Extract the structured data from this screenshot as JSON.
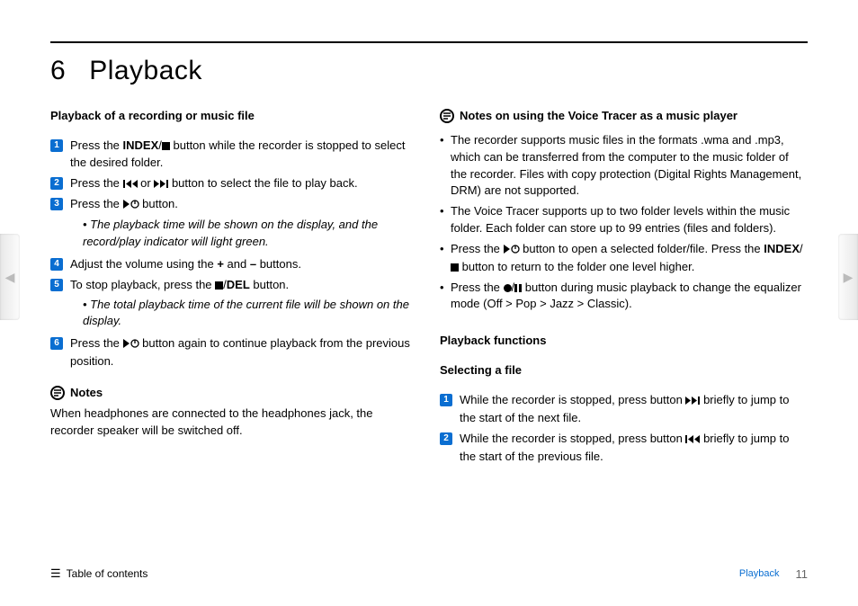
{
  "chapter_number": "6",
  "chapter_title": "Playback",
  "left": {
    "h1": "Playback of a recording or music file",
    "steps": [
      {
        "n": "1",
        "pre": "Press the ",
        "b1": "INDEX",
        "mid": "/",
        "icon": "stop",
        "post": " button while the recorder is stopped to select the desired folder."
      },
      {
        "n": "2",
        "text_a": "Press the ",
        "icon1": "rew",
        "text_b": " or ",
        "icon2": "fwd",
        "text_c": " button to select the file to play back."
      },
      {
        "n": "3",
        "text_a": "Press the ",
        "icon1": "play",
        "post": " button.",
        "sub": "The playback time will be shown on the display, and the record/play indicator will light green."
      },
      {
        "n": "4",
        "text_a": "Adjust the volume using the ",
        "b1": "+",
        "text_b": " and ",
        "b2": "–",
        "text_c": " buttons."
      },
      {
        "n": "5",
        "text_a": "To stop playback, press the ",
        "icon1": "stop",
        "text_b": "/",
        "b1": "DEL",
        "text_c": " button.",
        "sub": "The total playback time of the current file will be shown on the display."
      },
      {
        "n": "6",
        "text_a": "Press the ",
        "icon1": "play",
        "post": " button again to continue playback from the previous position."
      }
    ],
    "notes_label": "Notes",
    "notes_body": "When headphones are connected to the headphones jack, the recorder speaker will be switched off."
  },
  "right": {
    "notes_head": "Notes on using the Voice Tracer as a music player",
    "bullets": [
      {
        "text": "The recorder supports music files in the formats .wma and .mp3, which can be transferred from the computer to the music folder of the recorder. Files with copy protection (Digital Rights Management, DRM) are not supported."
      },
      {
        "text": "The Voice Tracer supports up to two folder levels within the music folder. Each folder can store up to 99 entries (files and folders)."
      },
      {
        "pre": "Press the ",
        "icon1": "play",
        "mid": " button to open a selected folder/file. Press the ",
        "b1": "INDEX",
        "mid2": "/",
        "icon2": "stop",
        "post": " button to return to the folder one level higher."
      },
      {
        "pre": "Press the ",
        "icon1": "rec",
        "mid": "/",
        "icon2": "pause",
        "post": " button during music playback to change the equalizer mode (Off > Pop > Jazz > Classic)."
      }
    ],
    "h2a": "Playback functions",
    "h2b": "Selecting a file",
    "steps": [
      {
        "n": "1",
        "text_a": "While the recorder is stopped, press button ",
        "icon": "fwd",
        "text_b": " briefly to jump to the start of the next file."
      },
      {
        "n": "2",
        "text_a": "While the recorder is stopped, press button ",
        "icon": "rew",
        "text_b": " briefly to jump to the start of the previous file."
      }
    ]
  },
  "footer": {
    "toc": "Table of contents",
    "section": "Playback",
    "page": "11"
  },
  "nav": {
    "prev": "◀",
    "next": "▶"
  }
}
